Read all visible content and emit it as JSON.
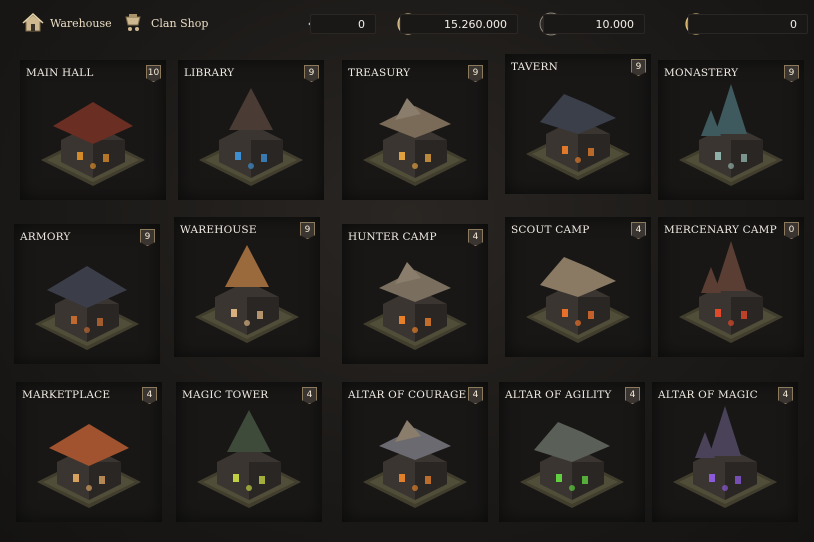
{
  "nav": {
    "warehouse_label": "Warehouse",
    "clanshop_label": "Clan Shop"
  },
  "resources": [
    {
      "name": "crystal",
      "value": "0",
      "icon": "crystal-icon",
      "color": "#4b8fd9"
    },
    {
      "name": "gold",
      "value": "15.260.000",
      "icon": "gold-coin-icon",
      "color": "#b59a64"
    },
    {
      "name": "skull",
      "value": "10.000",
      "icon": "skull-icon",
      "color": "#d9d3c8"
    },
    {
      "name": "medal",
      "value": "0",
      "icon": "medal-icon",
      "color": "#c9a557"
    }
  ],
  "buildings": [
    {
      "name": "MAIN HALL",
      "level": "10",
      "roof": "#6b2e22",
      "glow": "#d58a2a"
    },
    {
      "name": "LIBRARY",
      "level": "9",
      "roof": "#4a3b34",
      "glow": "#3d8fd1"
    },
    {
      "name": "TREASURY",
      "level": "9",
      "roof": "#7a6a58",
      "glow": "#e0a040"
    },
    {
      "name": "TAVERN",
      "level": "9",
      "roof": "#3b3f4a",
      "glow": "#e07a2a"
    },
    {
      "name": "MONASTERY",
      "level": "9",
      "roof": "#3f5a5e",
      "glow": "#8fb0a8"
    },
    {
      "name": "ARMORY",
      "level": "9",
      "roof": "#3b3d48",
      "glow": "#c06a30"
    },
    {
      "name": "WAREHOUSE",
      "level": "9",
      "roof": "#9a6a3c",
      "glow": "#d8b080"
    },
    {
      "name": "HUNTER CAMP",
      "level": "4",
      "roof": "#7a6e5e",
      "glow": "#e8802a"
    },
    {
      "name": "SCOUT CAMP",
      "level": "4",
      "roof": "#8a7a64",
      "glow": "#e8702a"
    },
    {
      "name": "MERCENARY CAMP",
      "level": "0",
      "roof": "#5a3e34",
      "glow": "#e04a2a"
    },
    {
      "name": "MARKETPLACE",
      "level": "4",
      "roof": "#a0532e",
      "glow": "#d8a060"
    },
    {
      "name": "MAGIC TOWER",
      "level": "4",
      "roof": "#3e4a3a",
      "glow": "#c0d040"
    },
    {
      "name": "ALTAR OF COURAGE",
      "level": "4",
      "roof": "#6a6a70",
      "glow": "#e0802a"
    },
    {
      "name": "ALTAR OF AGILITY",
      "level": "4",
      "roof": "#5a6058",
      "glow": "#60d040"
    },
    {
      "name": "ALTAR OF MAGIC",
      "level": "4",
      "roof": "#4a4258",
      "glow": "#8a5ad8"
    }
  ]
}
